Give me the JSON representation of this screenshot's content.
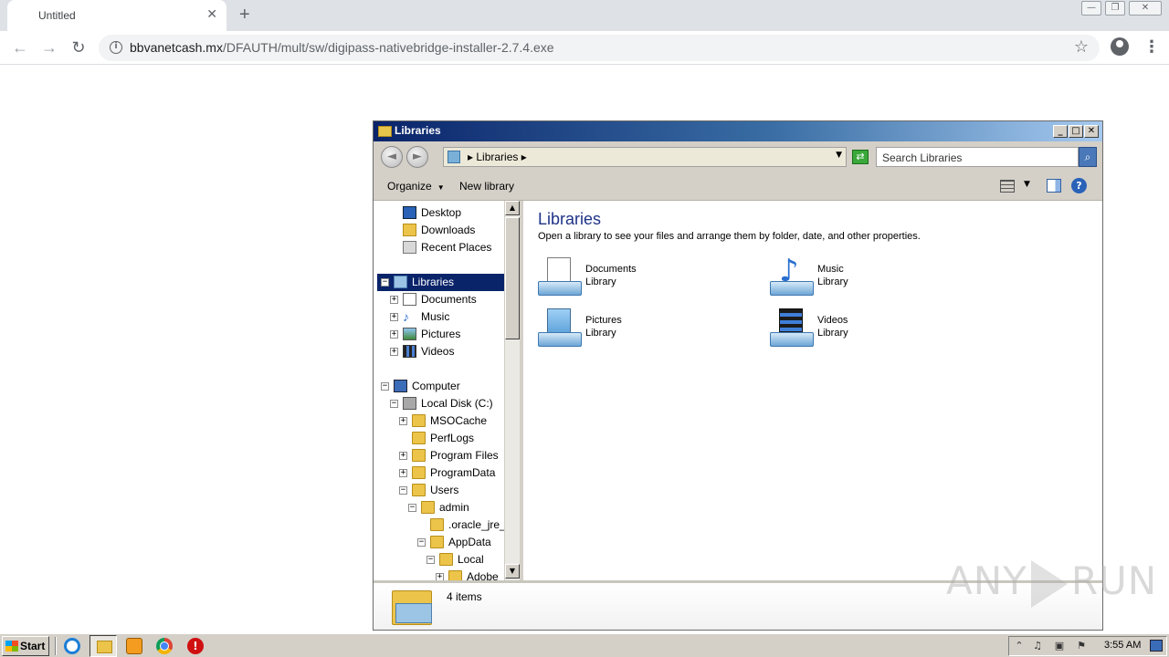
{
  "browser": {
    "tab_title": "Untitled",
    "tab_close": "✕",
    "new_tab": "+",
    "url_domain": "bbvanetcash.mx",
    "url_path": "/DFAUTH/mult/sw/digipass-nativebridge-installer-2.7.4.exe",
    "window_controls": [
      "—",
      "❐",
      "✕"
    ]
  },
  "explorer": {
    "title": "Libraries",
    "address": "Libraries",
    "search_placeholder": "Search Libraries",
    "toolbar": {
      "organize": "Organize",
      "new_library": "New library"
    },
    "nav_tree": [
      {
        "label": "Desktop",
        "icon": "desktop-icon"
      },
      {
        "label": "Downloads",
        "icon": "downloads-icon"
      },
      {
        "label": "Recent Places",
        "icon": "recent-places-icon"
      },
      {
        "label": "Libraries",
        "icon": "libraries-icon",
        "selected": true,
        "expander": "−"
      },
      {
        "label": "Documents",
        "icon": "documents-icon",
        "expander": "+"
      },
      {
        "label": "Music",
        "icon": "music-icon",
        "expander": "+"
      },
      {
        "label": "Pictures",
        "icon": "pictures-icon",
        "expander": "+"
      },
      {
        "label": "Videos",
        "icon": "videos-icon",
        "expander": "+"
      },
      {
        "label": "Computer",
        "icon": "computer-icon",
        "expander": "−"
      },
      {
        "label": "Local Disk (C:)",
        "icon": "local-disk-icon",
        "expander": "−"
      },
      {
        "label": "MSOCache",
        "icon": "folder-locked-icon",
        "expander": "+"
      },
      {
        "label": "PerfLogs",
        "icon": "folder-icon"
      },
      {
        "label": "Program Files",
        "icon": "folder-icon",
        "expander": "+"
      },
      {
        "label": "ProgramData",
        "icon": "folder-icon",
        "expander": "+"
      },
      {
        "label": "Users",
        "icon": "folder-icon",
        "expander": "−"
      },
      {
        "label": "admin",
        "icon": "folder-locked-icon",
        "expander": "−"
      },
      {
        "label": ".oracle_jre_",
        "icon": "folder-icon"
      },
      {
        "label": "AppData",
        "icon": "folder-icon",
        "expander": "−"
      },
      {
        "label": "Local",
        "icon": "folder-icon",
        "expander": "−"
      },
      {
        "label": "Adobe",
        "icon": "folder-icon",
        "expander": "+"
      }
    ],
    "content": {
      "heading": "Libraries",
      "subtitle": "Open a library to see your files and arrange them by folder, date, and other properties.",
      "libraries": [
        {
          "name": "Documents",
          "type": "Library",
          "icon": "documents-library-icon"
        },
        {
          "name": "Music",
          "type": "Library",
          "icon": "music-library-icon"
        },
        {
          "name": "Pictures",
          "type": "Library",
          "icon": "pictures-library-icon"
        },
        {
          "name": "Videos",
          "type": "Library",
          "icon": "videos-library-icon"
        }
      ]
    },
    "details": {
      "item_count": "4 items"
    }
  },
  "watermark": {
    "left": "ANY",
    "right": "RUN"
  },
  "taskbar": {
    "start_label": "Start",
    "clock": "3:55 AM",
    "stop_label": "!"
  }
}
